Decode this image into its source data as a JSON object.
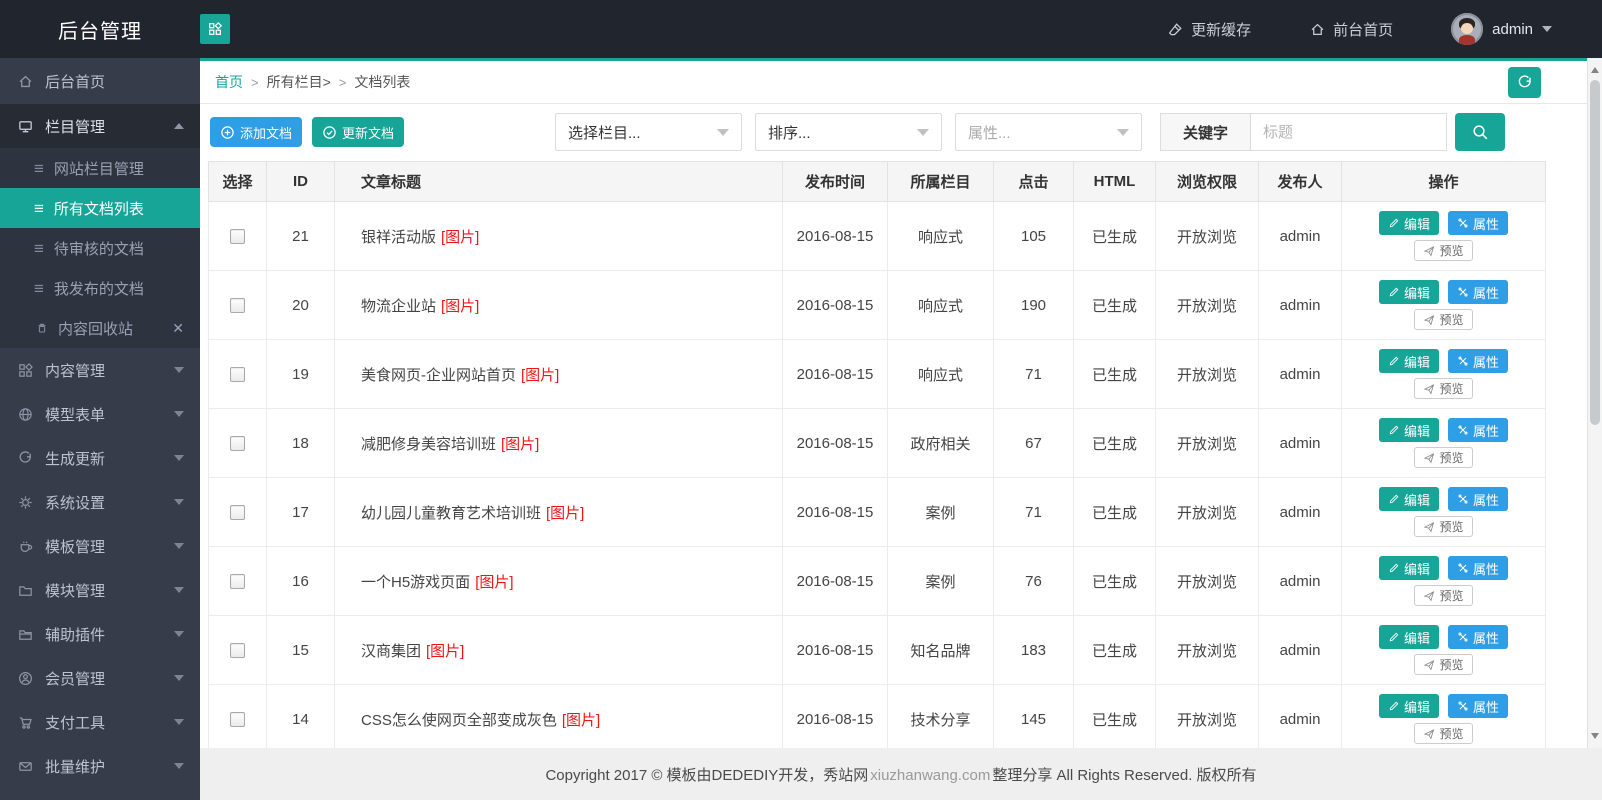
{
  "header": {
    "title": "后台管理",
    "refresh_cache": "更新缓存",
    "front_home": "前台首页",
    "username": "admin"
  },
  "sidebar": {
    "items": [
      {
        "label": "后台首页"
      },
      {
        "label": "栏目管理"
      },
      {
        "label": "网站栏目管理"
      },
      {
        "label": "所有文档列表"
      },
      {
        "label": "待审核的文档"
      },
      {
        "label": "我发布的文档"
      },
      {
        "label": "内容回收站"
      },
      {
        "label": "内容管理"
      },
      {
        "label": "模型表单"
      },
      {
        "label": "生成更新"
      },
      {
        "label": "系统设置"
      },
      {
        "label": "模板管理"
      },
      {
        "label": "模块管理"
      },
      {
        "label": "辅助插件"
      },
      {
        "label": "会员管理"
      },
      {
        "label": "支付工具"
      },
      {
        "label": "批量维护"
      }
    ],
    "close_glyph": "✕"
  },
  "breadcrumb": {
    "items": [
      "首页",
      "所有栏目>",
      "文档列表"
    ],
    "separator": ">"
  },
  "toolbar": {
    "add_button": "添加文档",
    "update_button": "更新文档",
    "category_select": "选择栏目...",
    "sort_select": "排序...",
    "attribute_select": "属性...",
    "keyword_label": "关键字",
    "keyword_placeholder": "标题"
  },
  "table": {
    "headers": [
      "选择",
      "ID",
      "文章标题",
      "发布时间",
      "所属栏目",
      "点击",
      "HTML",
      "浏览权限",
      "发布人",
      "操作"
    ],
    "image_tag": "[图片]",
    "row_actions": {
      "edit": "编辑",
      "attributes": "属性",
      "preview": "预览"
    },
    "rows": [
      {
        "id": "21",
        "title": "银祥活动版",
        "date": "2016-08-15",
        "category": "响应式",
        "clicks": "105",
        "html": "已生成",
        "permission": "开放浏览",
        "author": "admin"
      },
      {
        "id": "20",
        "title": "物流企业站",
        "date": "2016-08-15",
        "category": "响应式",
        "clicks": "190",
        "html": "已生成",
        "permission": "开放浏览",
        "author": "admin"
      },
      {
        "id": "19",
        "title": "美食网页-企业网站首页",
        "date": "2016-08-15",
        "category": "响应式",
        "clicks": "71",
        "html": "已生成",
        "permission": "开放浏览",
        "author": "admin"
      },
      {
        "id": "18",
        "title": "减肥修身美容培训班",
        "date": "2016-08-15",
        "category": "政府相关",
        "clicks": "67",
        "html": "已生成",
        "permission": "开放浏览",
        "author": "admin"
      },
      {
        "id": "17",
        "title": "幼儿园儿童教育艺术培训班",
        "date": "2016-08-15",
        "category": "案例",
        "clicks": "71",
        "html": "已生成",
        "permission": "开放浏览",
        "author": "admin"
      },
      {
        "id": "16",
        "title": "一个H5游戏页面",
        "date": "2016-08-15",
        "category": "案例",
        "clicks": "76",
        "html": "已生成",
        "permission": "开放浏览",
        "author": "admin"
      },
      {
        "id": "15",
        "title": "汉商集团",
        "date": "2016-08-15",
        "category": "知名品牌",
        "clicks": "183",
        "html": "已生成",
        "permission": "开放浏览",
        "author": "admin"
      },
      {
        "id": "14",
        "title": "CSS怎么使网页全部变成灰色",
        "date": "2016-08-15",
        "category": "技术分享",
        "clicks": "145",
        "html": "已生成",
        "permission": "开放浏览",
        "author": "admin"
      }
    ]
  },
  "footer": {
    "prefix": "Copyright 2017 © 模板由DEDEDIY开发，秀站网",
    "link": "xiuzhanwang.com",
    "suffix": "整理分享 All Rights Reserved. 版权所有"
  },
  "colors": {
    "accent_teal": "#17a598",
    "accent_blue": "#2e9fe6",
    "tag_red": "#f01515",
    "topbar_dark": "#21252e",
    "sidebar_dark": "#363c4a"
  }
}
